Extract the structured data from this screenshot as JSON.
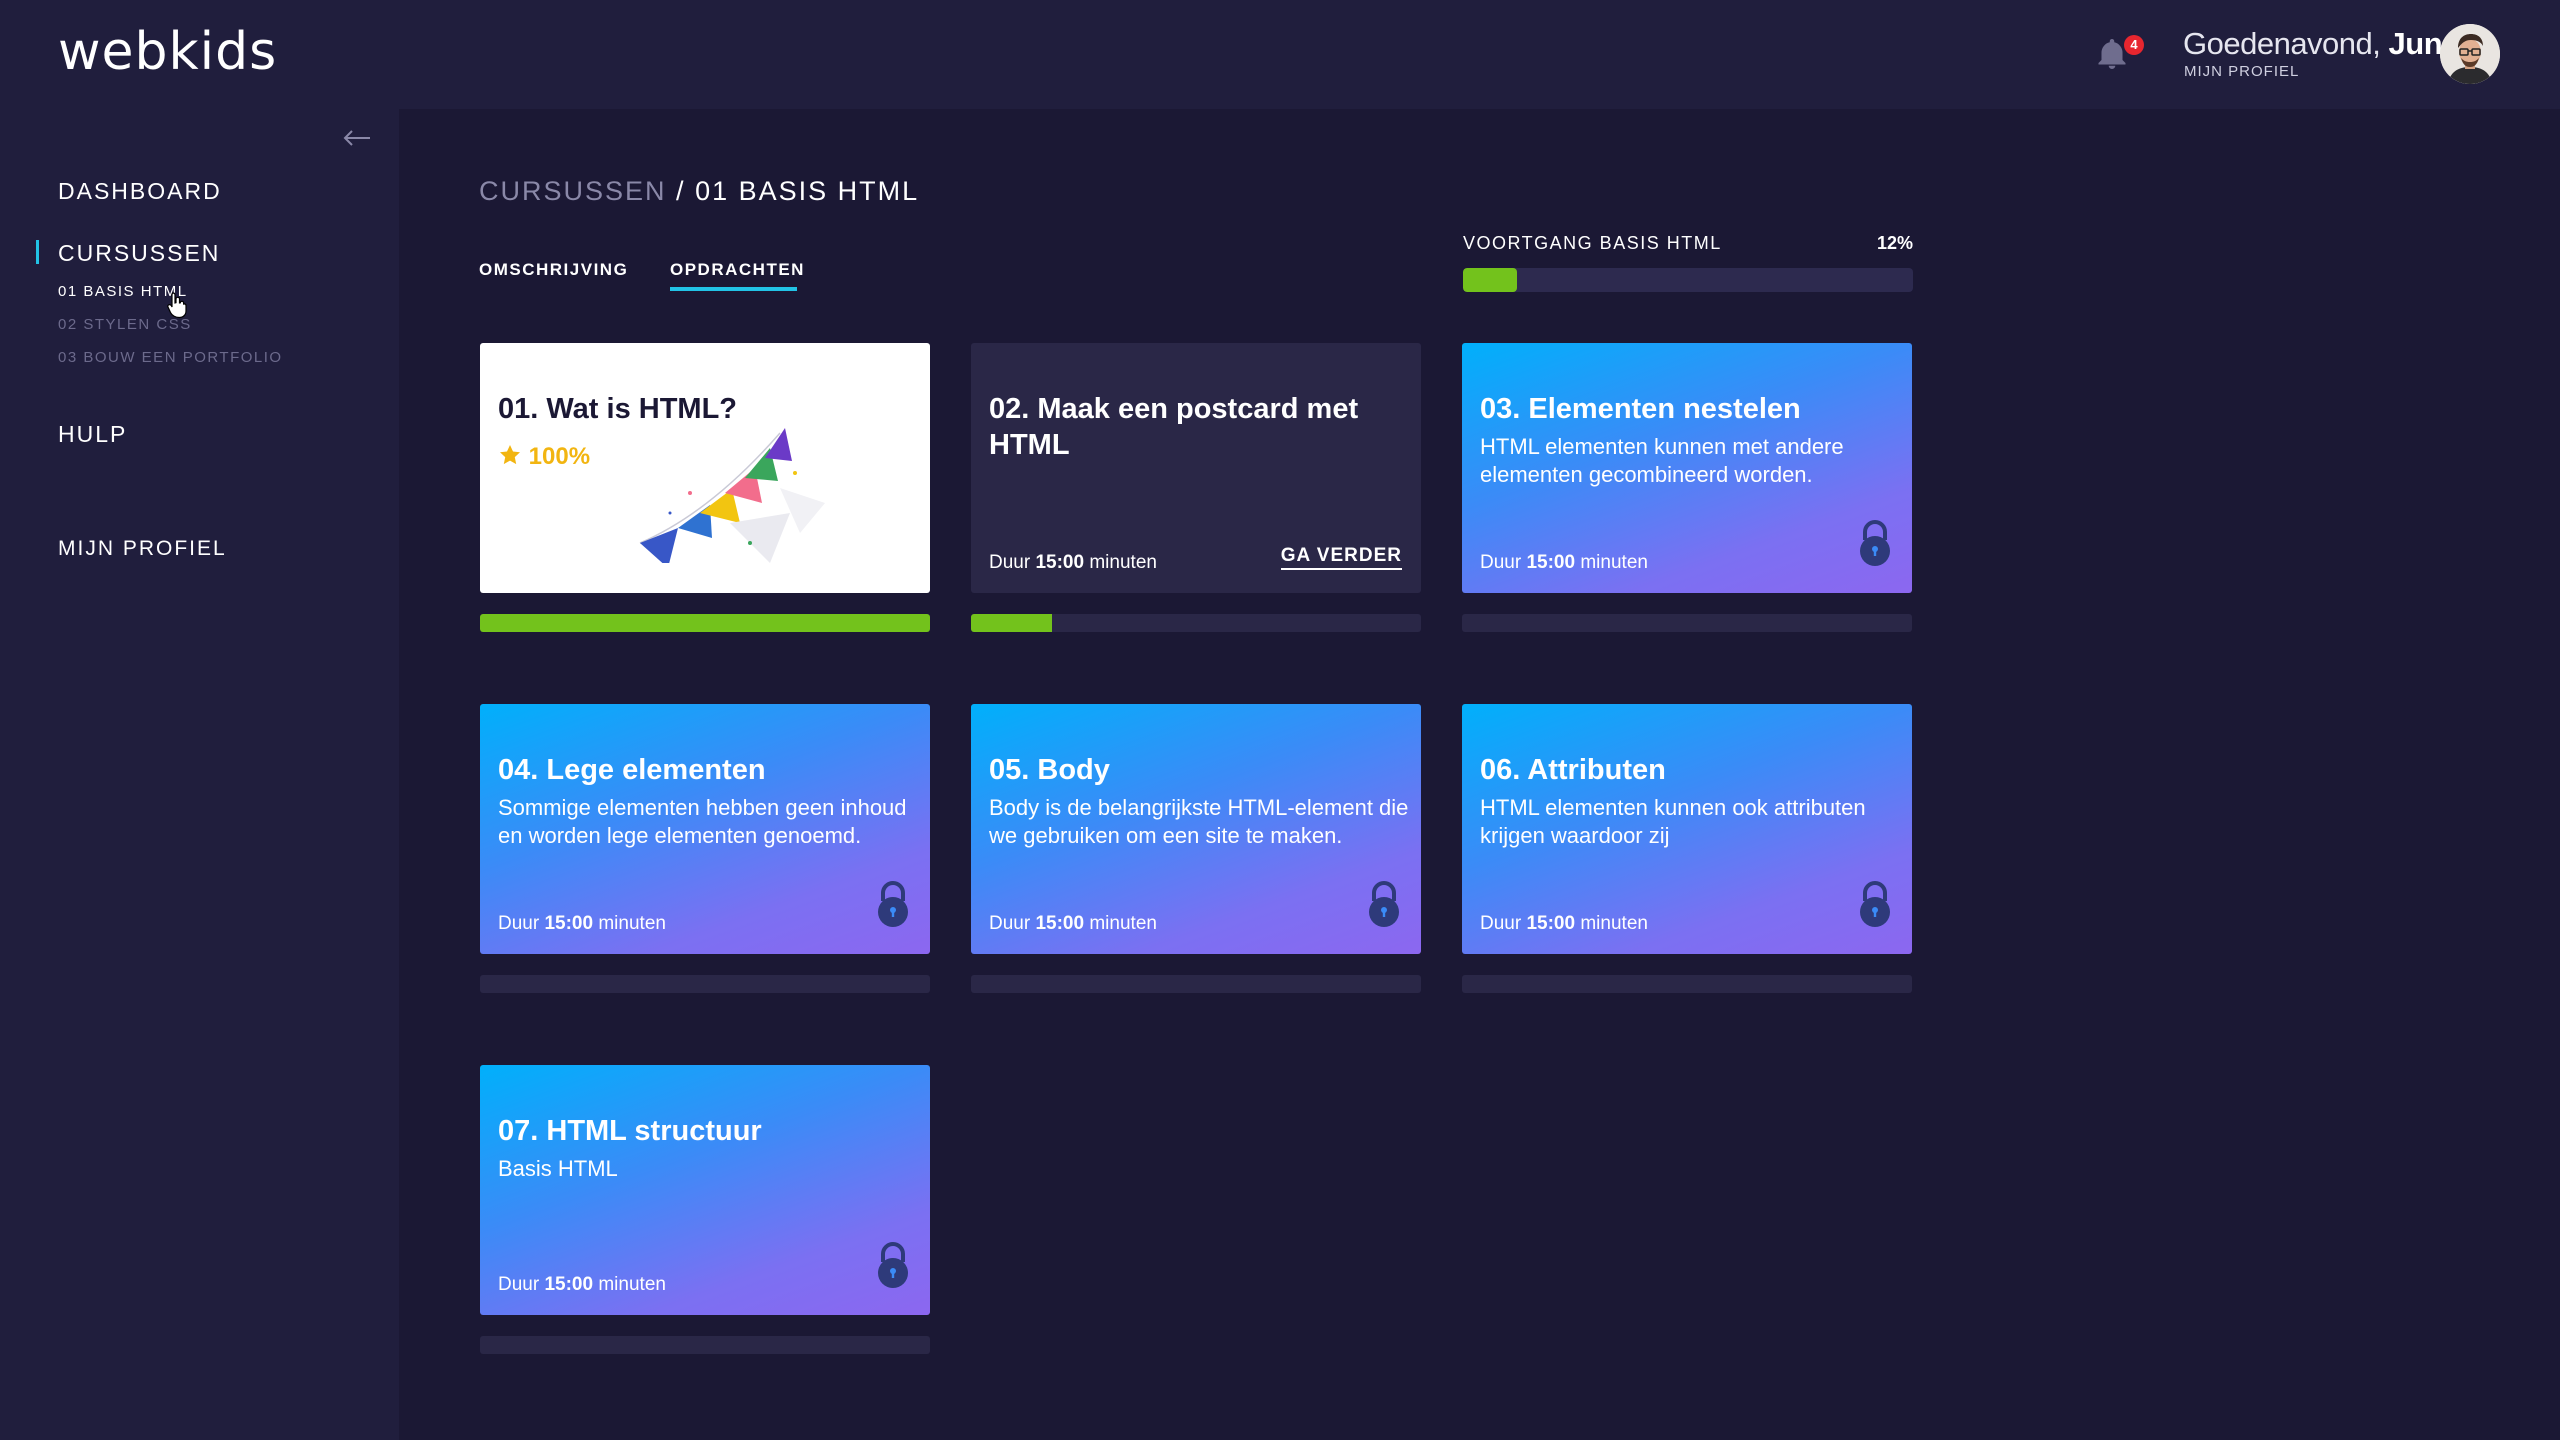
{
  "app": {
    "logo": "webkids"
  },
  "header": {
    "notifications_count": "4",
    "greeting_prefix": "Goedenavond,",
    "user_name": "Jun",
    "profile_link": "MIJN PROFIEL",
    "bell_icon": "bell-icon"
  },
  "sidebar": {
    "collapse_icon": "arrow-left-icon",
    "items": [
      {
        "label": "DASHBOARD"
      },
      {
        "label": "CURSUSSEN",
        "active": true
      },
      {
        "label": "HULP"
      },
      {
        "label": "MIJN PROFIEL"
      }
    ],
    "subitems": [
      {
        "label": "01 BASIS HTML",
        "active": true
      },
      {
        "label": "02 STYLEN CSS"
      },
      {
        "label": "03 BOUW EEN PORTFOLIO"
      }
    ]
  },
  "breadcrumb": {
    "parent": "CURSUSSEN",
    "separator": "/",
    "current": "01 BASIS HTML"
  },
  "tabs": [
    {
      "label": "OMSCHRIJVING"
    },
    {
      "label": "OPDRACHTEN",
      "active": true
    }
  ],
  "progress": {
    "label": "VOORTGANG BASIS HTML",
    "percent_label": "12%",
    "percent": 0.12,
    "color": "#73c21c"
  },
  "cards": [
    {
      "title": "01. Wat is HTML?",
      "score": "100%",
      "state": "done",
      "progress": 1.0
    },
    {
      "title": "02. Maak een postcard met HTML",
      "duration_prefix": "Duur",
      "duration": "15:00",
      "duration_suffix": "minuten",
      "cta": "GA VERDER",
      "state": "open",
      "progress": 0.18
    },
    {
      "title": "03. Elementen nestelen",
      "desc": "HTML elementen kunnen met andere elementen gecombineerd worden.",
      "duration_prefix": "Duur",
      "duration": "15:00",
      "duration_suffix": "minuten",
      "state": "locked",
      "progress": 0
    },
    {
      "title": "04. Lege elementen",
      "desc": "Sommige elementen hebben geen  inhoud en worden lege elementen genoemd.",
      "duration_prefix": "Duur",
      "duration": "15:00",
      "duration_suffix": "minuten",
      "state": "locked",
      "progress": 0
    },
    {
      "title": "05. Body",
      "desc": "Body is de belangrijkste HTML-element die we gebruiken om een site te maken.",
      "duration_prefix": "Duur",
      "duration": "15:00",
      "duration_suffix": "minuten",
      "state": "locked",
      "progress": 0
    },
    {
      "title": "06. Attributen",
      "desc": "HTML elementen kunnen ook attributen krijgen waardoor zij",
      "duration_prefix": "Duur",
      "duration": "15:00",
      "duration_suffix": "minuten",
      "state": "locked",
      "progress": 0
    },
    {
      "title": "07. HTML structuur",
      "desc": "Basis HTML",
      "duration_prefix": "Duur",
      "duration": "15:00",
      "duration_suffix": "minuten",
      "state": "locked",
      "progress": 0
    }
  ],
  "colors": {
    "accent": "#22c3e6",
    "success": "#73c21c",
    "score": "#f2b511",
    "badge": "#e7262f"
  }
}
